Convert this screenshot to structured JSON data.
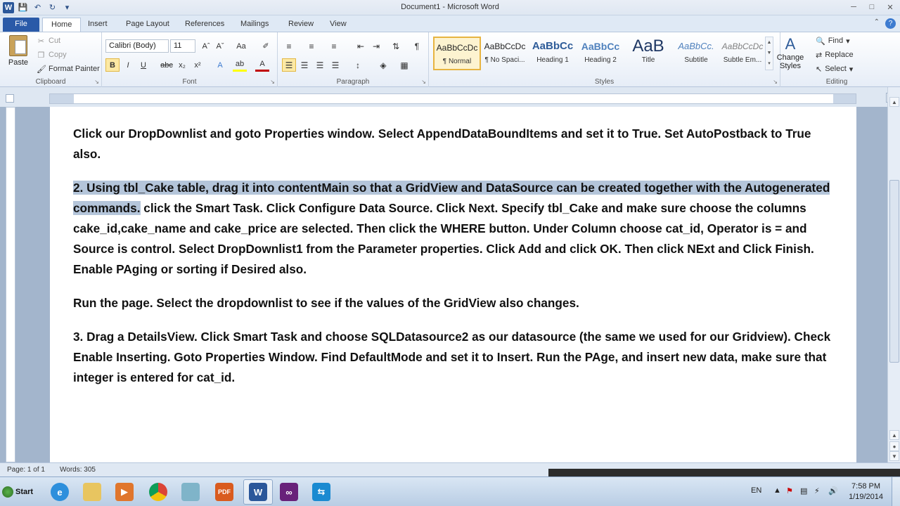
{
  "window": {
    "title": "Document1 - Microsoft Word",
    "app_letter": "W"
  },
  "tabs": [
    {
      "label": "File"
    },
    {
      "label": "Home"
    },
    {
      "label": "Insert"
    },
    {
      "label": "Page Layout"
    },
    {
      "label": "References"
    },
    {
      "label": "Mailings"
    },
    {
      "label": "Review"
    },
    {
      "label": "View"
    }
  ],
  "ribbon": {
    "clipboard": {
      "label": "Clipboard",
      "paste": "Paste",
      "cut": "Cut",
      "copy": "Copy",
      "format_painter": "Format Painter"
    },
    "font": {
      "label": "Font",
      "font_name": "Calibri (Body)",
      "font_size": "11"
    },
    "paragraph": {
      "label": "Paragraph"
    },
    "styles": {
      "label": "Styles",
      "items": [
        {
          "sample": "AaBbCcDc",
          "name": "¶ Normal"
        },
        {
          "sample": "AaBbCcDc",
          "name": "¶ No Spaci..."
        },
        {
          "sample": "AaBbCc",
          "name": "Heading 1"
        },
        {
          "sample": "AaBbCc",
          "name": "Heading 2"
        },
        {
          "sample": "AaB",
          "name": "Title"
        },
        {
          "sample": "AaBbCc.",
          "name": "Subtitle"
        },
        {
          "sample": "AaBbCcDc",
          "name": "Subtle Em..."
        }
      ],
      "change_styles": "Change Styles"
    },
    "editing": {
      "label": "Editing",
      "find": "Find",
      "replace": "Replace",
      "select": "Select"
    }
  },
  "document": {
    "p1": "Click our DropDownlist and goto Properties window. Select AppendDataBoundItems and set it to True. Set AutoPostback to True also.",
    "p2_highlighted": "2. Using tbl_Cake table, drag it into contentMain so that a GridView and DataSource can be created together with the Autogenerated commands.",
    "p2_rest": " click the Smart Task. Click Configure Data Source. Click Next. Specify tbl_Cake and make sure choose the columns cake_id,cake_name and cake_price are selected. Then click the WHERE button. Under Column choose cat_id, Operator is = and Source is control. Select DropDownlist1 from the Parameter properties. Click Add and click OK. Then click NExt and Click Finish. Enable PAging or sorting if Desired also.",
    "p3": "Run the page. Select the dropdownlist to see if the values of the GridView also changes.",
    "p4": "3. Drag a DetailsView. Click Smart Task and choose SQLDatasource2 as our datasource (the same we used for our Gridview). Check Enable Inserting. Goto Properties Window. Find DefaultMode and set it to Insert. Run the PAge, and insert new data, make sure that integer is entered for cat_id."
  },
  "status": {
    "page": "Page: 1 of 1",
    "words": "Words: 305"
  },
  "taskbar": {
    "start": "Start",
    "lang": "EN",
    "time": "7:58 PM",
    "date": "1/19/2014"
  },
  "colors": {
    "word_blue": "#2b579a",
    "selection": "#b4c5da",
    "ribbon_highlight": "#fce9a4"
  }
}
